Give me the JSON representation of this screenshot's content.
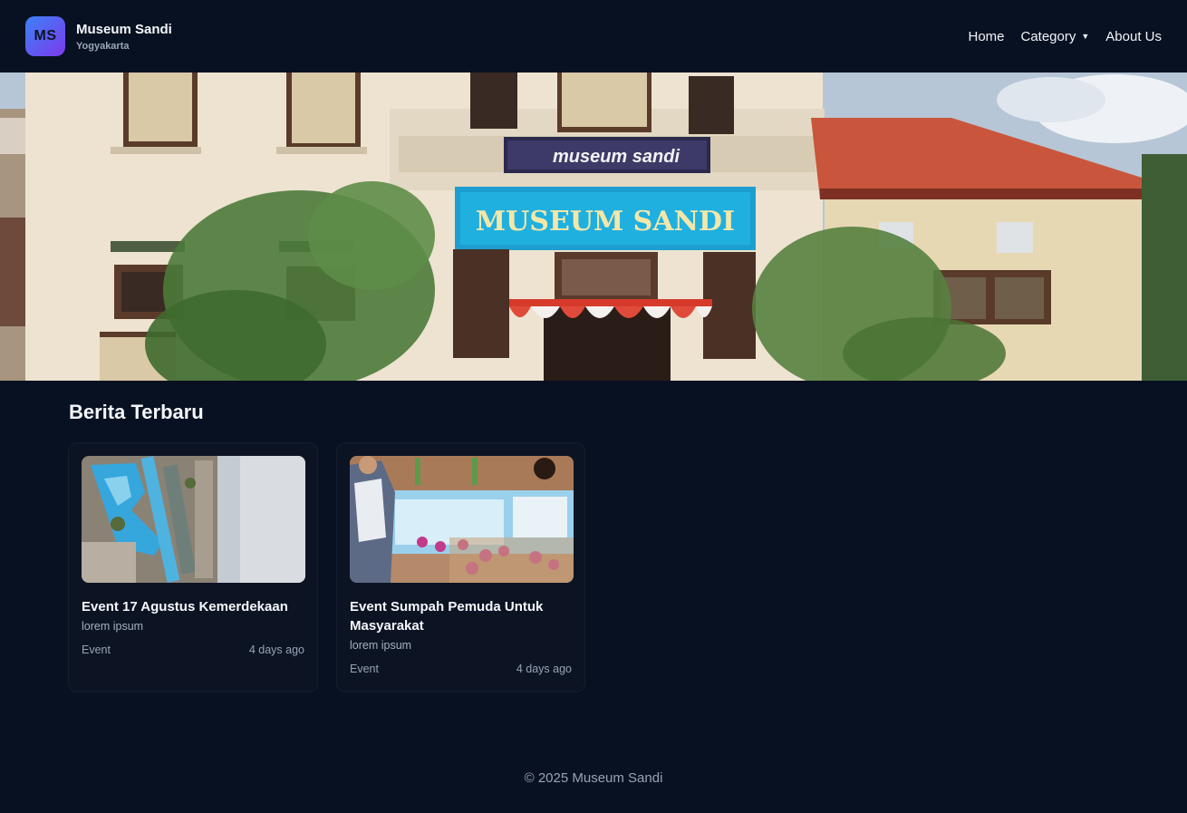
{
  "brand": {
    "logo_text": "MS",
    "name": "Museum Sandi",
    "city": "Yogyakarta"
  },
  "nav": {
    "home": "Home",
    "category": "Category",
    "about": "About Us"
  },
  "hero": {
    "sign_small": "museum sandi",
    "sign_large": "MUSEUM SANDI"
  },
  "news": {
    "heading": "Berita Terbaru",
    "items": [
      {
        "title": "Event 17 Agustus Kemerdekaan",
        "desc": "lorem ipsum",
        "category": "Event",
        "time": "4 days ago"
      },
      {
        "title": "Event Sumpah Pemuda Untuk Masyarakat",
        "desc": "lorem ipsum",
        "category": "Event",
        "time": "4 days ago"
      }
    ]
  },
  "footer": {
    "text": "© 2025 Museum Sandi"
  },
  "colors": {
    "background": "#081121",
    "card": "#0c1424",
    "accent_start": "#3b82f6",
    "accent_end": "#7c3aed"
  }
}
